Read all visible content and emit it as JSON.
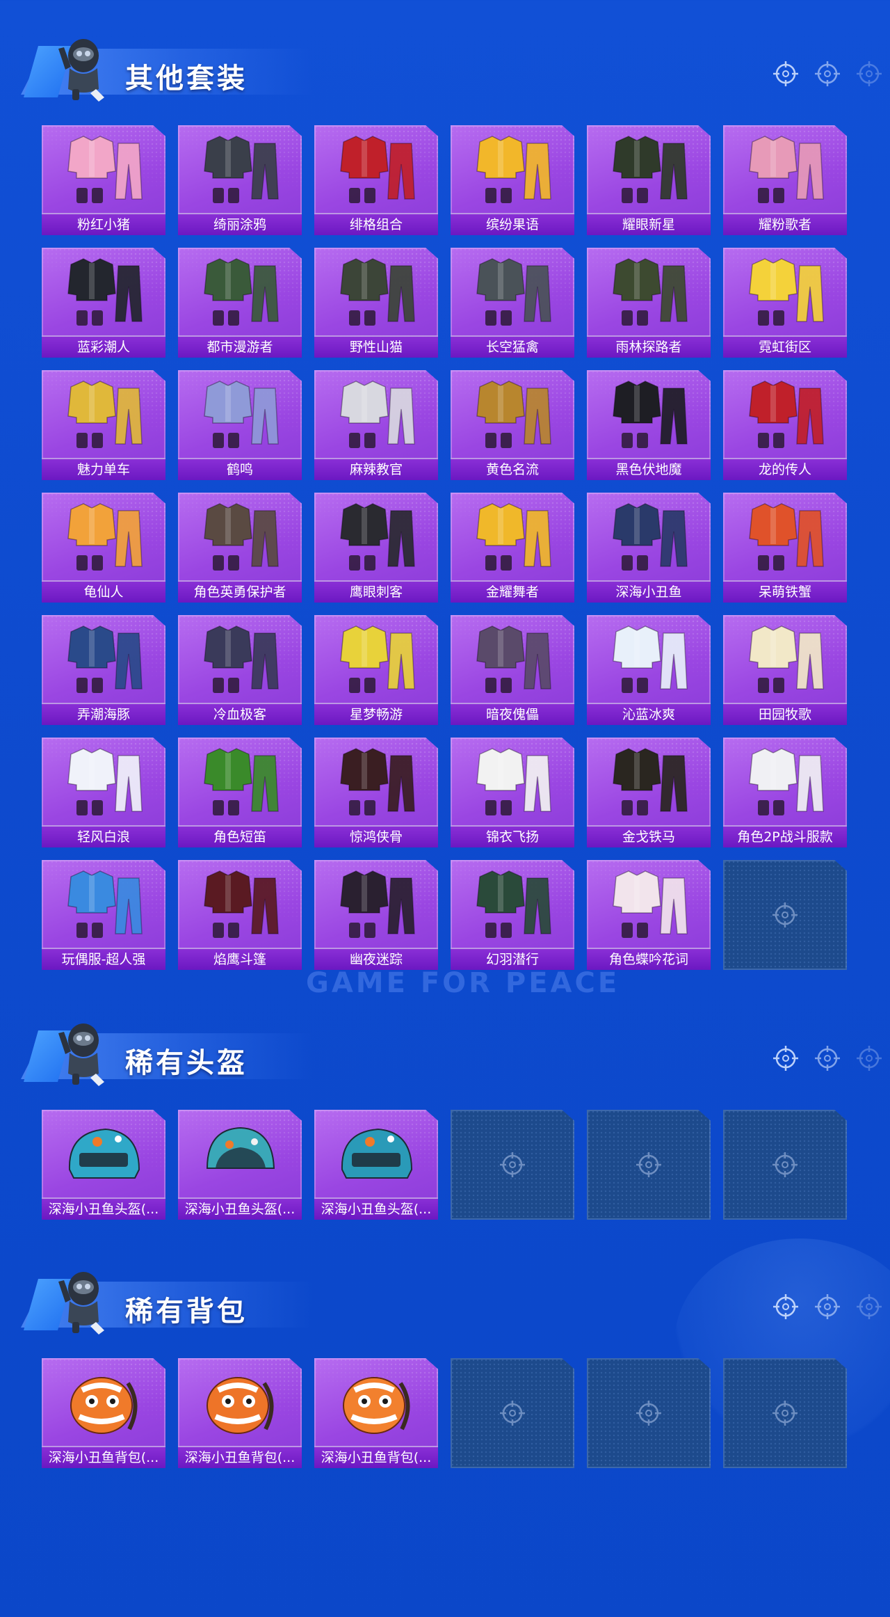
{
  "sections": [
    {
      "title": "其他套装",
      "items": [
        {
          "name": "粉红小猪",
          "color": "#f2a6c8"
        },
        {
          "name": "绮丽涂鸦",
          "color": "#3a3f4a"
        },
        {
          "name": "绯格组合",
          "color": "#c0202a"
        },
        {
          "name": "缤纷果语",
          "color": "#f2b72a"
        },
        {
          "name": "耀眼新星",
          "color": "#2f3a2a"
        },
        {
          "name": "耀粉歌者",
          "color": "#e79ab8"
        },
        {
          "name": "蓝彩潮人",
          "color": "#23262e"
        },
        {
          "name": "都市漫游者",
          "color": "#3a5a3a"
        },
        {
          "name": "野性山猫",
          "color": "#3c4538"
        },
        {
          "name": "长空猛禽",
          "color": "#4a5258"
        },
        {
          "name": "雨林探路者",
          "color": "#3d4a30"
        },
        {
          "name": "霓虹街区",
          "color": "#f4d23a"
        },
        {
          "name": "魅力单车",
          "color": "#e0b83a"
        },
        {
          "name": "鹤鸣",
          "color": "#8f9ad8"
        },
        {
          "name": "麻辣教官",
          "color": "#d8d8e0"
        },
        {
          "name": "黄色名流",
          "color": "#b8862e"
        },
        {
          "name": "黑色伏地魔",
          "color": "#1e1e24"
        },
        {
          "name": "龙的传人",
          "color": "#c0202a"
        },
        {
          "name": "龟仙人",
          "color": "#f2a23a"
        },
        {
          "name": "角色英勇保护者",
          "color": "#5a4a42"
        },
        {
          "name": "鹰眼刺客",
          "color": "#2a2a30"
        },
        {
          "name": "金耀舞者",
          "color": "#f0b82a"
        },
        {
          "name": "深海小丑鱼",
          "color": "#2a3a6a"
        },
        {
          "name": "呆萌铁蟹",
          "color": "#e0522a"
        },
        {
          "name": "弄潮海豚",
          "color": "#2a4a8a"
        },
        {
          "name": "冷血极客",
          "color": "#3a3a5a"
        },
        {
          "name": "星梦畅游",
          "color": "#e8d23a"
        },
        {
          "name": "暗夜傀儡",
          "color": "#5a4a6a"
        },
        {
          "name": "沁蓝冰爽",
          "color": "#e8f0fa"
        },
        {
          "name": "田园牧歌",
          "color": "#f2e8c8"
        },
        {
          "name": "轻风白浪",
          "color": "#f0f2fa"
        },
        {
          "name": "角色短笛",
          "color": "#3a8a2a"
        },
        {
          "name": "惊鸿侠骨",
          "color": "#3a1e22"
        },
        {
          "name": "锦衣飞扬",
          "color": "#f2f2f2"
        },
        {
          "name": "金戈铁马",
          "color": "#2a2620"
        },
        {
          "name": "角色2P战斗服款",
          "color": "#f0f0f4"
        },
        {
          "name": "玩偶服-超人强",
          "color": "#3a8ae0"
        },
        {
          "name": "焰鹰斗篷",
          "color": "#5a1a22"
        },
        {
          "name": "幽夜迷踪",
          "color": "#2a2030"
        },
        {
          "name": "幻羽潜行",
          "color": "#2a4a3a"
        },
        {
          "name": "角色蝶吟花词",
          "color": "#f2e4ec"
        }
      ],
      "empty_slots": 1
    },
    {
      "title": "稀有头盔",
      "items": [
        {
          "name": "深海小丑鱼头盔(...",
          "color": "#2fa8c8"
        },
        {
          "name": "深海小丑鱼头盔(...",
          "color": "#3aa8b8"
        },
        {
          "name": "深海小丑鱼头盔(...",
          "color": "#2a9ab8"
        }
      ],
      "empty_slots": 3
    },
    {
      "title": "稀有背包",
      "items": [
        {
          "name": "深海小丑鱼背包(...",
          "color": "#f07a2a"
        },
        {
          "name": "深海小丑鱼背包(...",
          "color": "#ee7428"
        },
        {
          "name": "深海小丑鱼背包(...",
          "color": "#f2802e"
        }
      ],
      "empty_slots": 3
    }
  ],
  "decor": {
    "watermark": "GAME FOR PEACE"
  },
  "icons": {
    "crosshair": "crosshair-icon",
    "mascot": "mascot-icon"
  }
}
